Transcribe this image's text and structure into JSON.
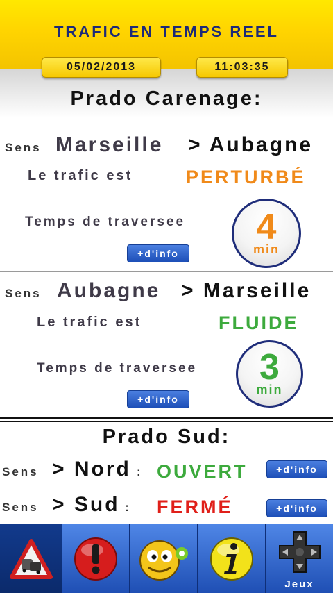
{
  "header": {
    "title": "TRAFIC EN TEMPS REEL",
    "date": "05/02/2013",
    "time": "11:03:35"
  },
  "section1": {
    "title": "Prado Carenage:",
    "dir1": {
      "sens": "Sens",
      "from": "Marseille",
      "to": "> Aubagne",
      "trafic_label": "Le trafic est",
      "status": "PERTURBÉ",
      "status_color": "#f08a1a",
      "time_label": "Temps de traversee",
      "minutes": "4",
      "unit": "min",
      "info": "+d'info"
    },
    "dir2": {
      "sens": "Sens",
      "from": "Aubagne",
      "to": "> Marseille",
      "trafic_label": "Le trafic est",
      "status": "FLUIDE",
      "status_color": "#3daa3d",
      "time_label": "Temps de traversee",
      "minutes": "3",
      "unit": "min",
      "info": "+d'info"
    }
  },
  "section2": {
    "title": "Prado Sud:",
    "nord": {
      "sens": "Sens",
      "dir": "> Nord",
      "colon": ":",
      "status": "OUVERT",
      "status_color": "#3daa3d",
      "info": "+d'info"
    },
    "sud": {
      "sens": "Sens",
      "dir": "> Sud",
      "colon": ":",
      "status": "FERMÉ",
      "status_color": "#e0201a",
      "info": "+d'info"
    }
  },
  "tabbar": {
    "items": [
      {
        "icon": "traffic-jam-warning-icon",
        "label": ""
      },
      {
        "icon": "alert-exclamation-icon",
        "label": ""
      },
      {
        "icon": "mascot-icon",
        "label": ""
      },
      {
        "icon": "info-icon",
        "label": ""
      },
      {
        "icon": "gamepad-icon",
        "label": "Jeux"
      }
    ]
  }
}
